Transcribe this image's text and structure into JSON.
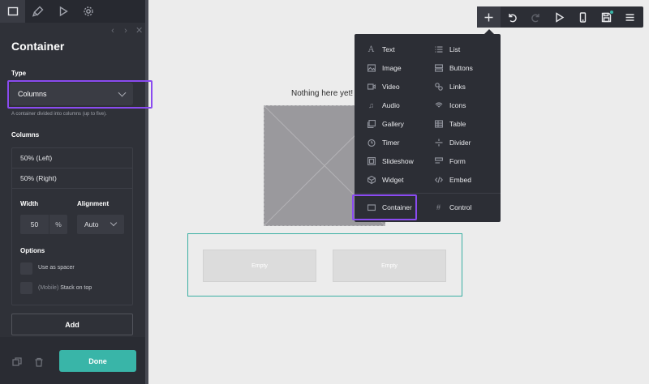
{
  "sidebar": {
    "tabs": [
      {
        "icon": "layout-icon",
        "active": true
      },
      {
        "icon": "brush-icon",
        "active": false
      },
      {
        "icon": "play-icon",
        "active": false
      },
      {
        "icon": "gear-icon",
        "active": false
      }
    ],
    "title": "Container",
    "type_label": "Type",
    "type_value": "Columns",
    "type_hint": "A container divided into columns (up to five).",
    "columns_label": "Columns",
    "columns": [
      "50% (Left)",
      "50% (Right)"
    ],
    "width_label": "Width",
    "width_value": "50",
    "width_unit": "%",
    "alignment_label": "Alignment",
    "alignment_value": "Auto",
    "options_label": "Options",
    "option_spacer": "Use as spacer",
    "option_stack_prefix": "(Mobile)",
    "option_stack": "Stack on top",
    "add_label": "Add",
    "done_label": "Done"
  },
  "canvas": {
    "message": "Nothing here yet! :",
    "empty_left": "Empty",
    "empty_right": "Empty"
  },
  "toolbar": {
    "buttons": [
      "add-icon",
      "undo-icon",
      "redo-icon",
      "preview-icon",
      "mobile-icon",
      "save-icon",
      "menu-icon"
    ]
  },
  "add_menu": {
    "left": [
      {
        "label": "Text",
        "icon": "text-icon"
      },
      {
        "label": "Image",
        "icon": "image-icon"
      },
      {
        "label": "Video",
        "icon": "video-icon"
      },
      {
        "label": "Audio",
        "icon": "audio-icon"
      },
      {
        "label": "Gallery",
        "icon": "gallery-icon"
      },
      {
        "label": "Timer",
        "icon": "timer-icon"
      },
      {
        "label": "Slideshow",
        "icon": "slideshow-icon"
      },
      {
        "label": "Widget",
        "icon": "widget-icon"
      }
    ],
    "right": [
      {
        "label": "List",
        "icon": "list-icon"
      },
      {
        "label": "Buttons",
        "icon": "buttons-icon"
      },
      {
        "label": "Links",
        "icon": "link-icon"
      },
      {
        "label": "Icons",
        "icon": "icons-icon"
      },
      {
        "label": "Table",
        "icon": "table-icon"
      },
      {
        "label": "Divider",
        "icon": "divider-icon"
      },
      {
        "label": "Form",
        "icon": "form-icon"
      },
      {
        "label": "Embed",
        "icon": "embed-icon"
      }
    ],
    "container_label": "Container",
    "control_label": "Control"
  },
  "colors": {
    "sidebar_bg": "#2f3138",
    "accent_teal": "#39b5a8",
    "highlight_purple": "#8a4bf0",
    "canvas_bg": "#ececec"
  }
}
